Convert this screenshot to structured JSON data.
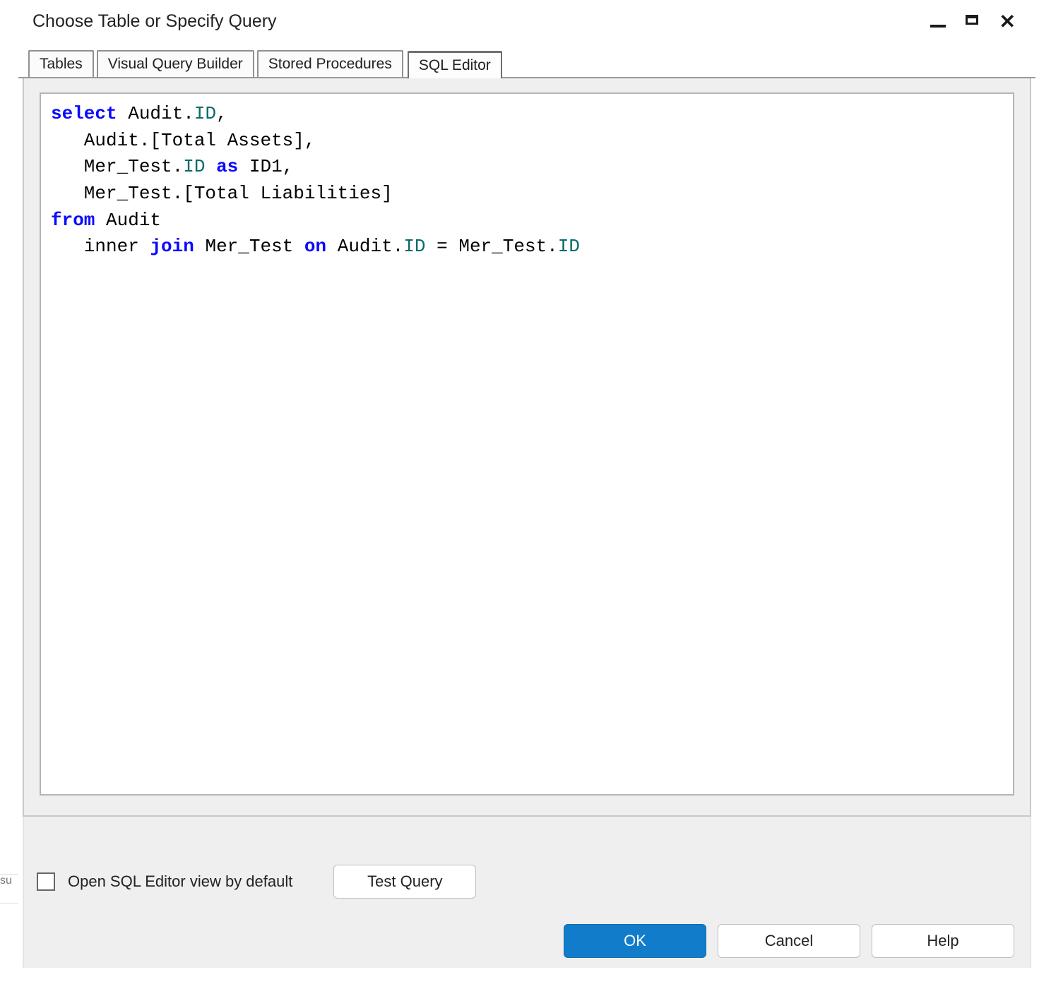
{
  "window": {
    "title": "Choose Table or Specify Query"
  },
  "tabs": [
    {
      "label": "Tables"
    },
    {
      "label": "Visual Query Builder"
    },
    {
      "label": "Stored Procedures"
    },
    {
      "label": "SQL Editor"
    }
  ],
  "sql": {
    "tokens": [
      {
        "t": "kw",
        "v": "select"
      },
      {
        "t": "sp",
        "v": " "
      },
      {
        "t": "tx",
        "v": "Audit."
      },
      {
        "t": "id",
        "v": "ID"
      },
      {
        "t": "tx",
        "v": ","
      },
      {
        "t": "nl"
      },
      {
        "t": "sp",
        "v": "   "
      },
      {
        "t": "tx",
        "v": "Audit.[Total Assets],"
      },
      {
        "t": "nl"
      },
      {
        "t": "sp",
        "v": "   "
      },
      {
        "t": "tx",
        "v": "Mer_Test."
      },
      {
        "t": "id",
        "v": "ID"
      },
      {
        "t": "sp",
        "v": " "
      },
      {
        "t": "kw",
        "v": "as"
      },
      {
        "t": "sp",
        "v": " "
      },
      {
        "t": "tx",
        "v": "ID1,"
      },
      {
        "t": "nl"
      },
      {
        "t": "sp",
        "v": "   "
      },
      {
        "t": "tx",
        "v": "Mer_Test.[Total Liabilities]"
      },
      {
        "t": "nl"
      },
      {
        "t": "kw",
        "v": "from"
      },
      {
        "t": "sp",
        "v": " "
      },
      {
        "t": "tx",
        "v": "Audit"
      },
      {
        "t": "nl"
      },
      {
        "t": "sp",
        "v": "   "
      },
      {
        "t": "tx",
        "v": "inner "
      },
      {
        "t": "kw",
        "v": "join"
      },
      {
        "t": "sp",
        "v": " "
      },
      {
        "t": "tx",
        "v": "Mer_Test "
      },
      {
        "t": "kw",
        "v": "on"
      },
      {
        "t": "sp",
        "v": " "
      },
      {
        "t": "tx",
        "v": "Audit."
      },
      {
        "t": "id",
        "v": "ID"
      },
      {
        "t": "sp",
        "v": " "
      },
      {
        "t": "tx",
        "v": "= Mer_Test."
      },
      {
        "t": "id",
        "v": "ID"
      }
    ]
  },
  "options": {
    "open_by_default_label": "Open SQL Editor view by default",
    "test_query_label": "Test Query"
  },
  "buttons": {
    "ok": "OK",
    "cancel": "Cancel",
    "help": "Help"
  }
}
